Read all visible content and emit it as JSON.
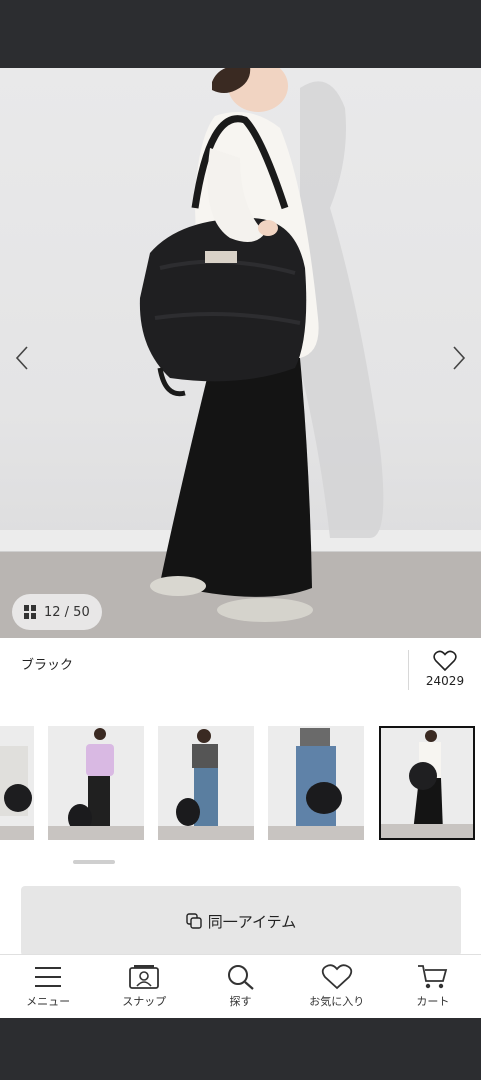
{
  "gallery": {
    "current": "12",
    "total": "50",
    "counter_text": "12 / 50"
  },
  "product": {
    "color_label": "ブラック",
    "favorite_count": "24029"
  },
  "thumbnails": [
    {
      "name": "thumb-partial",
      "active": false
    },
    {
      "name": "thumb-lavender-tee",
      "active": false
    },
    {
      "name": "thumb-striped-top",
      "active": false
    },
    {
      "name": "thumb-denim-bag",
      "active": false
    },
    {
      "name": "thumb-white-sweat-active",
      "active": true
    }
  ],
  "same_item_button": {
    "label": "同一アイテム"
  },
  "tabbar": {
    "menu": "メニュー",
    "snap": "スナップ",
    "search": "探す",
    "favorites": "お気に入り",
    "cart": "カート"
  },
  "colors": {
    "system_bar": "#2c2d30",
    "accent_dark": "#111111",
    "button_bg": "#e6e6e6"
  }
}
